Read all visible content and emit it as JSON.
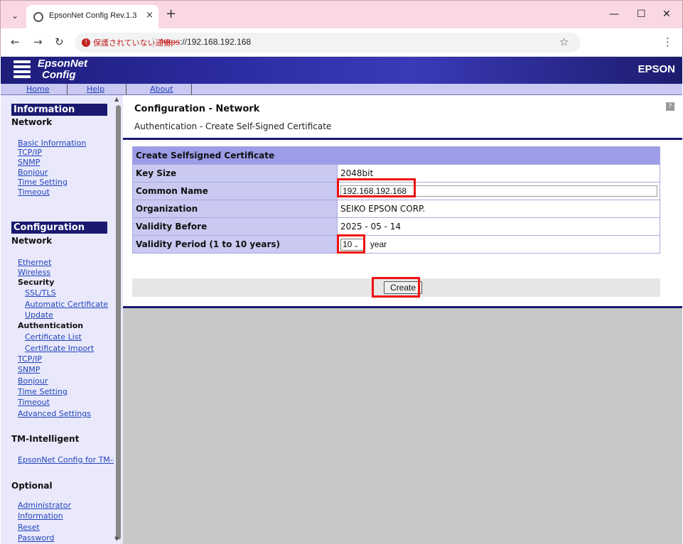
{
  "browser": {
    "tab_title": "EpsonNet Config Rev.1.3",
    "tab_close": "×",
    "new_tab": "+",
    "security_label": "保護されていない通信",
    "url_scheme": "https",
    "url_rest": "://192.168.192.168"
  },
  "header": {
    "logo_line1": "EpsonNet",
    "logo_line2": "Config",
    "brand": "EPSON"
  },
  "menubar": {
    "home": "Home",
    "help": "Help",
    "about": "About"
  },
  "sidebar": {
    "information_head": "Information",
    "info_network": "Network",
    "info_items": [
      "Basic Information",
      "TCP/IP",
      "SNMP",
      "Bonjour",
      "Time Setting",
      "Timeout"
    ],
    "configuration_head": "Configuration",
    "conf_network": "Network",
    "ethernet": "Ethernet",
    "wireless": "Wireless",
    "security": "Security",
    "ssl_tls": "SSL/TLS",
    "automatic_certificate": "Automatic Certificate",
    "update": "Update",
    "authentication": "Authentication",
    "certificate_list": "Certificate List",
    "certificate_import": "Certificate Import",
    "tcpip": "TCP/IP",
    "snmp": "SNMP",
    "bonjour": "Bonjour",
    "time_setting": "Time Setting",
    "timeout": "Timeout",
    "advanced_settings": "Advanced Settings",
    "tm_head": "TM-Intelligent",
    "tm_link": "EpsonNet Config for TM-i",
    "optional_head": "Optional",
    "administrator": "Administrator",
    "information": "Information",
    "reset": "Reset",
    "password": "Password"
  },
  "main": {
    "title": "Configuration - Network",
    "subtitle": "Authentication - Create Self-Signed Certificate",
    "help_icon": "?",
    "table_header": "Create Selfsigned Certificate",
    "key_size_label": "Key Size",
    "key_size_value": "2048bit",
    "common_name_label": "Common Name",
    "common_name_value": "192.168.192.168",
    "organization_label": "Organization",
    "organization_value": "SEIKO EPSON CORP.",
    "validity_before_label": "Validity Before",
    "validity_before_value": "2025 - 05 - 14",
    "validity_period_label": "Validity Period (1 to 10 years)",
    "validity_period_value": "10",
    "validity_period_unit": "year",
    "create_button": "Create"
  },
  "colors": {
    "highlight": "#ee1111",
    "nav_dark": "#191970",
    "table_header": "#9c9ce8",
    "table_label": "#c9c9f2"
  }
}
